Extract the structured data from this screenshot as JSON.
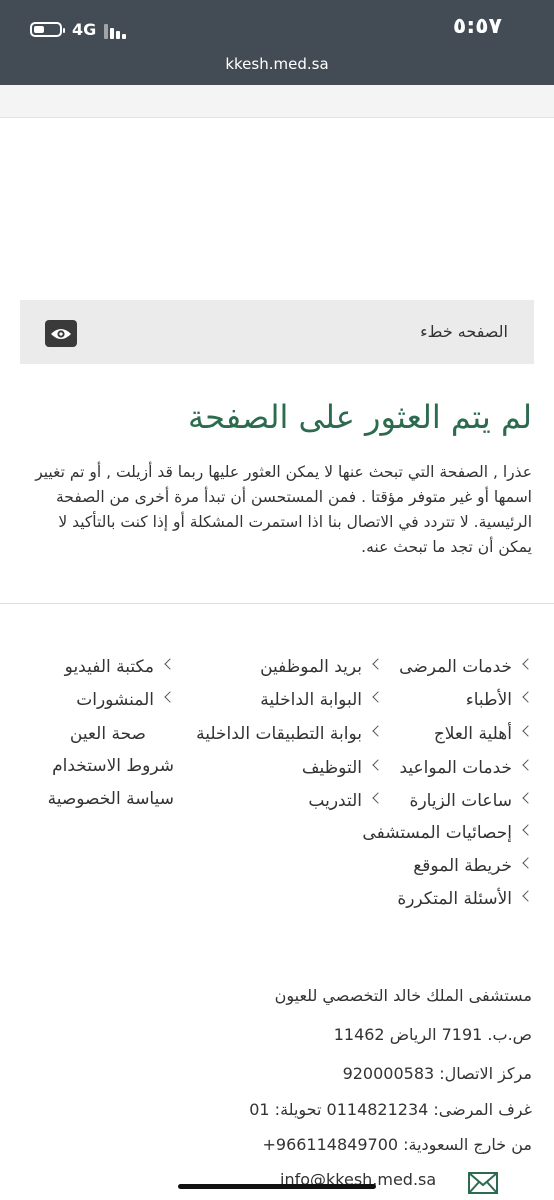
{
  "status_bar": {
    "time": "٥:٥٧",
    "network": "4G",
    "url": "kkesh.med.sa"
  },
  "error_bar": {
    "label": "الصفحه خطء",
    "icon": "eye-icon"
  },
  "heading": "لم يتم العثور على الصفحة",
  "message": "عذرا , الصفحة التي تبحث عنها لا يمكن العثور عليها ربما قد أزيلت , أو تم تغيير اسمها أو غير متوفر مؤقتا . فمن المستحسن أن تبدأ مرة أخرى من الصفحة الرئيسية. لا تتردد في الاتصال بنا اذا استمرت المشكلة أو إذا كنت بالتأكيد لا يمكن أن تجد ما تبحث عنه.",
  "footer_links": {
    "col1": [
      "خدمات المرضى",
      "الأطباء",
      "أهلية العلاج",
      "خدمات المواعيد",
      "ساعات الزيارة",
      "إحصائيات المستشفى",
      "خريطة الموقع",
      "الأسئلة المتكررة"
    ],
    "col2": [
      "بريد الموظفين",
      "البوابة الداخلية",
      "بوابة التطبيقات الداخلية",
      "التوظيف",
      "التدريب"
    ],
    "col3": [
      "مكتبة الفيديو",
      "المنشورات",
      "صحة العين",
      "شروط الاستخدام",
      "سياسة الخصوصية"
    ]
  },
  "contact": {
    "name": "مستشفى الملك خالد التخصصي للعيون",
    "po_box": "ص.ب. 7191 الرياض 11462",
    "call_center": "مركز الاتصال: 920000583",
    "patient_rooms": "غرف المرضى: 0114821234 تحويلة: 01",
    "outside_ksa": "من خارج السعودية: 966114849700+",
    "email": "info@kkesh.med.sa"
  },
  "colors": {
    "heading": "#2d6b4e",
    "status_bar": "#434b54"
  }
}
